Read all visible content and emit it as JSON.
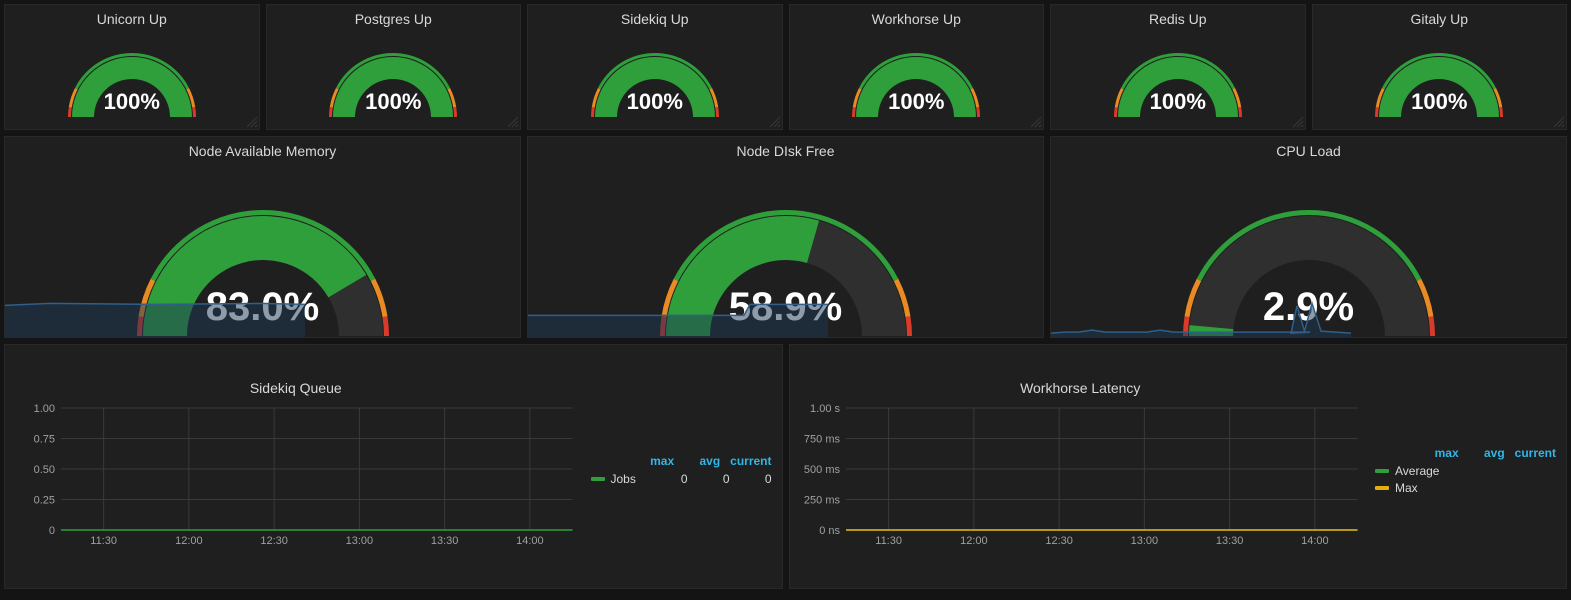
{
  "colors": {
    "green": "#2e9f3a",
    "orange": "#e98b22",
    "red": "#d93b2b",
    "track": "#2f2f2f",
    "spark_stroke": "#2f5f8a",
    "spark_fill": "#1d3a55",
    "legend_blue": "#33b5e5",
    "max_yellow": "#e5ac0e"
  },
  "top_gauges": [
    {
      "title": "Unicorn Up",
      "value": 100,
      "display": "100%"
    },
    {
      "title": "Postgres Up",
      "value": 100,
      "display": "100%"
    },
    {
      "title": "Sidekiq Up",
      "value": 100,
      "display": "100%"
    },
    {
      "title": "Workhorse Up",
      "value": 100,
      "display": "100%"
    },
    {
      "title": "Redis Up",
      "value": 100,
      "display": "100%"
    },
    {
      "title": "Gitaly Up",
      "value": 100,
      "display": "100%"
    }
  ],
  "mid_gauges": [
    {
      "title": "Node Available Memory",
      "value": 83.0,
      "display": "83.0%",
      "spark": "flat-high"
    },
    {
      "title": "Node DIsk Free",
      "value": 58.9,
      "display": "58.9%",
      "spark": "step-up"
    },
    {
      "title": "CPU Load",
      "value": 2.9,
      "display": "2.9%",
      "spark": "low-spikes"
    }
  ],
  "chart_data": [
    {
      "type": "line",
      "title": "Sidekiq Queue",
      "x_ticks": [
        "11:30",
        "12:00",
        "12:30",
        "13:00",
        "13:30",
        "14:00"
      ],
      "y_ticks": [
        "0",
        "0.25",
        "0.50",
        "0.75",
        "1.00"
      ],
      "ylim": [
        0,
        1.0
      ],
      "series": [
        {
          "name": "Jobs",
          "color": "#2e9f3a",
          "values": [
            0,
            0,
            0,
            0,
            0,
            0,
            0,
            0,
            0,
            0,
            0,
            0
          ]
        }
      ],
      "legend_columns": [
        "max",
        "avg",
        "current"
      ],
      "legend_rows": [
        {
          "name": "Jobs",
          "color": "#2e9f3a",
          "max": "0",
          "avg": "0",
          "current": "0"
        }
      ]
    },
    {
      "type": "line",
      "title": "Workhorse Latency",
      "x_ticks": [
        "11:30",
        "12:00",
        "12:30",
        "13:00",
        "13:30",
        "14:00"
      ],
      "y_ticks": [
        "0 ns",
        "250 ms",
        "500 ms",
        "750 ms",
        "1.00 s"
      ],
      "ylim": [
        0,
        1.0
      ],
      "series": [
        {
          "name": "Average",
          "color": "#2e9f3a",
          "values": [
            0,
            0,
            0,
            0,
            0,
            0,
            0,
            0,
            0,
            0,
            0,
            0
          ]
        },
        {
          "name": "Max",
          "color": "#e5ac0e",
          "values": [
            0,
            0,
            0,
            0,
            0,
            0,
            0,
            0,
            0,
            0,
            0,
            0
          ]
        }
      ],
      "legend_columns": [
        "max",
        "avg",
        "current"
      ],
      "legend_rows": [
        {
          "name": "Average",
          "color": "#2e9f3a"
        },
        {
          "name": "Max",
          "color": "#e5ac0e"
        }
      ]
    }
  ]
}
